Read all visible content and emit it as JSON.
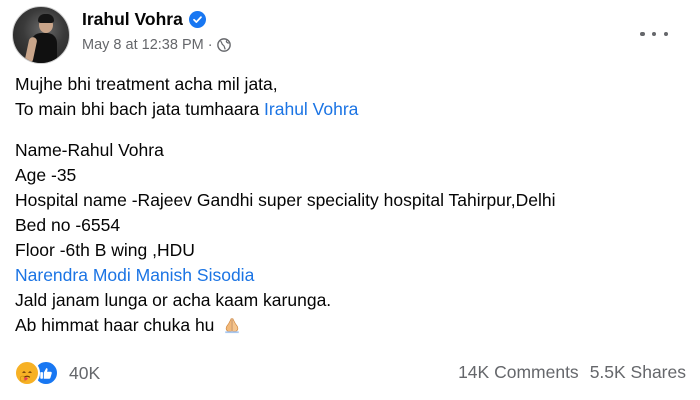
{
  "post": {
    "author": "Irahul Vohra",
    "timestamp": "May 8 at 12:38 PM",
    "separator": "·",
    "lines_intro": [
      "Mujhe bhi treatment acha mil jata,",
      "To main bhi bach jata tumhaara"
    ],
    "intro_mention": "Irahul Vohra",
    "details": [
      "Name-Rahul Vohra",
      "Age -35",
      "Hospital name -Rajeev Gandhi super speciality hospital Tahirpur,Delhi",
      "Bed no -6554",
      "Floor -6th B wing ,HDU"
    ],
    "mentions_line": [
      "Narendra Modi",
      "Manish Sisodia"
    ],
    "closing": [
      "Jald janam lunga or acha kaam karunga.",
      "Ab himmat haar chuka hu"
    ]
  },
  "footer": {
    "reaction_count": "40K",
    "comments": "14K Comments",
    "shares": "5.5K Shares"
  },
  "icons": {
    "verified": "verified-badge-icon",
    "privacy": "globe-icon",
    "more": "more-options-icon",
    "emoji": "folded-hands-icon",
    "reactions": [
      "care-icon",
      "like-icon"
    ]
  },
  "colors": {
    "accent": "#1877f2",
    "link": "#1b74e4",
    "muted": "#65676b",
    "text": "#050505"
  }
}
